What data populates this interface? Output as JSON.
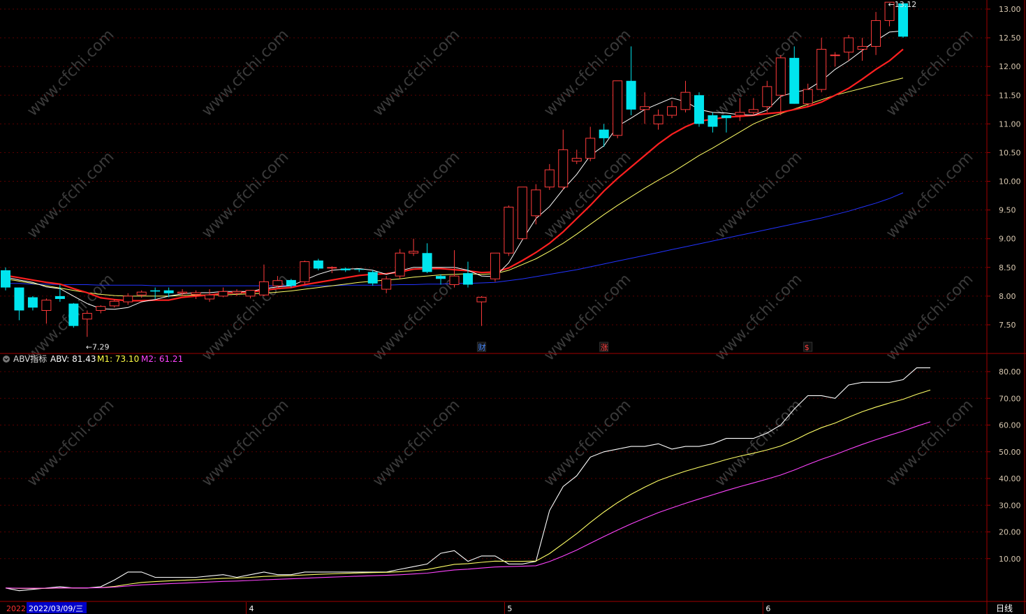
{
  "colors": {
    "up": "#ff3b3b",
    "down": "#00e5ee",
    "ma5": "#ffffff",
    "ma10": "#ff2020",
    "ma20": "#ffff66",
    "ma60": "#2233ff",
    "abv": "#ffffff",
    "m1": "#ffff66",
    "m2": "#ff44ff",
    "frame": "#a00000",
    "grid": "#5a0000",
    "axis_text": "#d8c8b0"
  },
  "price_panel": {
    "y_ticks": [
      "13.00",
      "12.50",
      "12.00",
      "11.50",
      "11.00",
      "10.50",
      "10.00",
      "9.50",
      "9.00",
      "8.50",
      "8.00",
      "7.50"
    ],
    "low_marker": "7.29",
    "high_marker": "13.12",
    "event_badges": [
      {
        "text": "财",
        "bar_index": 35,
        "color": "#4a8cff"
      },
      {
        "text": "涨",
        "bar_index": 44,
        "color": "#ff4040"
      },
      {
        "text": "$",
        "bar_index": 59,
        "color": "#ff4040"
      }
    ]
  },
  "indicator_panel": {
    "name": "ABV指标",
    "abv_label": "ABV: 81.43",
    "m1_label": "M1: 73.10",
    "m2_label": "M2: 61.21",
    "y_ticks": [
      "80.00",
      "70.00",
      "60.00",
      "50.00",
      "40.00",
      "30.00",
      "20.00",
      "10.00"
    ]
  },
  "x_axis": {
    "start_year": "2022",
    "cursor_date": "2022/03/09/三",
    "month_labels": [
      {
        "text": "4",
        "bar_index": 18
      },
      {
        "text": "5",
        "bar_index": 37
      },
      {
        "text": "6",
        "bar_index": 56
      }
    ],
    "period": "日线"
  },
  "watermark": "www.cfchi.com",
  "chart_data": {
    "type": "candlestick",
    "candles": [
      [
        8.45,
        8.15,
        8.5,
        8.1
      ],
      [
        8.15,
        7.75,
        8.15,
        7.58
      ],
      [
        7.98,
        7.8,
        8.0,
        7.75
      ],
      [
        7.75,
        7.93,
        7.96,
        7.52
      ],
      [
        8.0,
        7.95,
        8.2,
        7.9
      ],
      [
        7.87,
        7.48,
        7.88,
        7.45
      ],
      [
        7.6,
        7.7,
        7.75,
        7.29
      ],
      [
        7.75,
        7.82,
        7.84,
        7.7
      ],
      [
        7.83,
        7.91,
        7.95,
        7.8
      ],
      [
        7.9,
        8.0,
        8.05,
        7.85
      ],
      [
        8.02,
        8.07,
        8.1,
        7.97
      ],
      [
        8.1,
        8.08,
        8.15,
        7.95
      ],
      [
        8.1,
        8.05,
        8.15,
        7.98
      ],
      [
        8.05,
        8.07,
        8.12,
        8.0
      ],
      [
        8.03,
        8.06,
        8.1,
        7.95
      ],
      [
        7.95,
        8.02,
        8.12,
        7.9
      ],
      [
        8.0,
        8.08,
        8.15,
        7.98
      ],
      [
        8.05,
        8.08,
        8.12,
        8.0
      ],
      [
        8.0,
        8.1,
        8.1,
        7.96
      ],
      [
        8.02,
        8.25,
        8.55,
        8.0
      ],
      [
        8.18,
        8.27,
        8.35,
        8.15
      ],
      [
        8.28,
        8.18,
        8.3,
        8.15
      ],
      [
        8.25,
        8.6,
        8.62,
        8.2
      ],
      [
        8.62,
        8.48,
        8.65,
        8.45
      ],
      [
        8.5,
        8.5,
        8.52,
        8.4
      ],
      [
        8.48,
        8.45,
        8.5,
        8.42
      ],
      [
        8.47,
        8.46,
        8.48,
        8.42
      ],
      [
        8.42,
        8.22,
        8.45,
        8.18
      ],
      [
        8.12,
        8.3,
        8.35,
        8.05
      ],
      [
        8.35,
        8.75,
        8.82,
        8.3
      ],
      [
        8.75,
        8.78,
        9.0,
        8.7
      ],
      [
        8.75,
        8.42,
        8.92,
        8.4
      ],
      [
        8.35,
        8.3,
        8.38,
        8.2
      ],
      [
        8.2,
        8.35,
        8.8,
        8.15
      ],
      [
        8.4,
        8.2,
        8.6,
        8.15
      ],
      [
        7.9,
        7.98,
        8.0,
        7.48
      ],
      [
        8.3,
        8.75,
        8.75,
        8.25
      ],
      [
        8.75,
        9.55,
        9.58,
        8.7
      ],
      [
        9.0,
        9.9,
        9.9,
        8.98
      ],
      [
        9.4,
        9.85,
        9.95,
        9.25
      ],
      [
        9.9,
        10.2,
        10.3,
        9.85
      ],
      [
        9.9,
        10.55,
        10.9,
        9.85
      ],
      [
        10.35,
        10.4,
        10.55,
        10.3
      ],
      [
        10.4,
        10.75,
        10.95,
        10.35
      ],
      [
        10.9,
        10.75,
        11.0,
        10.6
      ],
      [
        10.8,
        11.75,
        11.75,
        10.75
      ],
      [
        11.75,
        11.25,
        12.35,
        11.15
      ],
      [
        11.25,
        11.3,
        11.55,
        11.0
      ],
      [
        11.0,
        11.15,
        11.25,
        10.9
      ],
      [
        11.15,
        11.3,
        11.4,
        11.1
      ],
      [
        11.25,
        11.55,
        11.75,
        11.2
      ],
      [
        11.5,
        11.0,
        11.55,
        10.95
      ],
      [
        11.15,
        10.95,
        11.2,
        10.85
      ],
      [
        11.15,
        11.1,
        11.15,
        10.85
      ],
      [
        11.15,
        11.2,
        11.45,
        11.05
      ],
      [
        11.2,
        11.25,
        11.45,
        11.15
      ],
      [
        11.3,
        11.65,
        11.75,
        11.2
      ],
      [
        11.5,
        12.15,
        12.2,
        11.15
      ],
      [
        12.15,
        11.35,
        12.35,
        11.35
      ],
      [
        11.35,
        11.6,
        11.7,
        11.3
      ],
      [
        11.6,
        12.3,
        12.5,
        11.55
      ],
      [
        12.2,
        12.2,
        12.25,
        12.0
      ],
      [
        12.25,
        12.5,
        12.55,
        12.1
      ],
      [
        12.3,
        12.35,
        12.5,
        12.1
      ],
      [
        12.35,
        12.8,
        12.95,
        12.2
      ],
      [
        12.8,
        13.12,
        13.12,
        12.7
      ],
      [
        13.1,
        12.52,
        13.12,
        12.5
      ]
    ],
    "ma5": [
      8.33,
      8.28,
      8.24,
      8.16,
      8.13,
      8.0,
      7.87,
      7.78,
      7.77,
      7.8,
      7.9,
      7.94,
      8.0,
      8.04,
      8.06,
      8.06,
      8.08,
      8.08,
      8.08,
      8.13,
      8.16,
      8.18,
      8.28,
      8.38,
      8.45,
      8.47,
      8.48,
      8.45,
      8.38,
      8.44,
      8.5,
      8.5,
      8.5,
      8.5,
      8.45,
      8.35,
      8.34,
      8.58,
      8.98,
      9.35,
      9.56,
      9.86,
      10.12,
      10.45,
      10.62,
      10.96,
      11.1,
      11.25,
      11.35,
      11.45,
      11.39,
      11.25,
      11.2,
      11.19,
      11.16,
      11.15,
      11.24,
      11.48,
      11.55,
      11.6,
      11.75,
      11.95,
      12.1,
      12.28,
      12.45,
      12.6,
      12.62
    ],
    "ma10": [
      8.36,
      8.32,
      8.28,
      8.24,
      8.21,
      8.13,
      8.06,
      7.97,
      7.94,
      7.92,
      7.92,
      7.93,
      7.93,
      7.98,
      8.0,
      8.02,
      8.05,
      8.06,
      8.07,
      8.1,
      8.13,
      8.15,
      8.2,
      8.24,
      8.28,
      8.32,
      8.36,
      8.38,
      8.39,
      8.42,
      8.47,
      8.48,
      8.48,
      8.46,
      8.44,
      8.41,
      8.42,
      8.49,
      8.62,
      8.76,
      8.92,
      9.12,
      9.35,
      9.58,
      9.83,
      10.05,
      10.25,
      10.45,
      10.65,
      10.82,
      10.95,
      11.05,
      11.08,
      11.12,
      11.13,
      11.15,
      11.18,
      11.2,
      11.25,
      11.3,
      11.38,
      11.5,
      11.62,
      11.78,
      11.95,
      12.1,
      12.3
    ],
    "ma20": [
      8.3,
      8.26,
      8.22,
      8.18,
      8.14,
      8.1,
      8.06,
      8.03,
      8.01,
      8.0,
      8.0,
      8.0,
      8.0,
      8.01,
      8.02,
      8.02,
      8.02,
      8.03,
      8.04,
      8.05,
      8.07,
      8.09,
      8.12,
      8.15,
      8.18,
      8.21,
      8.24,
      8.26,
      8.28,
      8.3,
      8.33,
      8.35,
      8.37,
      8.38,
      8.39,
      8.38,
      8.39,
      8.45,
      8.55,
      8.65,
      8.78,
      8.92,
      9.08,
      9.25,
      9.42,
      9.58,
      9.73,
      9.88,
      10.02,
      10.15,
      10.3,
      10.45,
      10.58,
      10.72,
      10.86,
      11.0,
      11.1,
      11.18,
      11.26,
      11.34,
      11.42,
      11.5,
      11.56,
      11.62,
      11.68,
      11.74,
      11.8
    ],
    "ma60": [
      8.22,
      8.22,
      8.21,
      8.21,
      8.2,
      8.2,
      8.2,
      8.19,
      8.19,
      8.19,
      8.19,
      8.18,
      8.18,
      8.18,
      8.18,
      8.18,
      8.18,
      8.18,
      8.18,
      8.18,
      8.18,
      8.18,
      8.18,
      8.18,
      8.18,
      8.19,
      8.19,
      8.19,
      8.19,
      8.2,
      8.2,
      8.21,
      8.21,
      8.22,
      8.22,
      8.23,
      8.24,
      8.27,
      8.3,
      8.34,
      8.38,
      8.42,
      8.46,
      8.51,
      8.56,
      8.61,
      8.66,
      8.71,
      8.76,
      8.81,
      8.86,
      8.91,
      8.96,
      9.01,
      9.06,
      9.11,
      9.16,
      9.21,
      9.26,
      9.31,
      9.36,
      9.42,
      9.48,
      9.55,
      9.62,
      9.7,
      9.8
    ],
    "abv": [
      -1,
      -2,
      -1.5,
      -1,
      -0.5,
      -1,
      -1,
      -0.5,
      2,
      5,
      5,
      3,
      3,
      3,
      3,
      3.5,
      4,
      3,
      4,
      5,
      4,
      4,
      5,
      5,
      5,
      5,
      5,
      5,
      5,
      6,
      7,
      8,
      12,
      13,
      9,
      11,
      11,
      8,
      8,
      9,
      28,
      37,
      41,
      48,
      50,
      51,
      52,
      52,
      53,
      51,
      52,
      52,
      53,
      55,
      55,
      55,
      57,
      60,
      66,
      71,
      71,
      70,
      75,
      76,
      76,
      76,
      77,
      81.4,
      81.4
    ]
  }
}
